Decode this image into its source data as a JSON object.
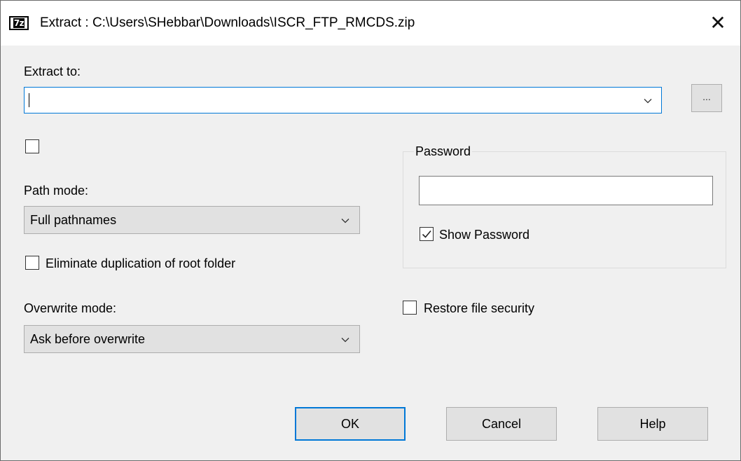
{
  "window": {
    "title": "Extract : C:\\Users\\SHebbar\\Downloads\\ISCR_FTP_RMCDS.zip",
    "app_icon_text": "7z",
    "close_glyph": "✕"
  },
  "extract_to": {
    "label": "Extract to:",
    "value": "",
    "browse_label": "..."
  },
  "extra_checkbox": {
    "checked": false
  },
  "path_mode": {
    "label": "Path mode:",
    "selected": "Full pathnames"
  },
  "eliminate_duplication": {
    "label": "Eliminate duplication of root folder",
    "checked": false
  },
  "overwrite_mode": {
    "label": "Overwrite mode:",
    "selected": "Ask before overwrite"
  },
  "password_group": {
    "title": "Password",
    "value": "",
    "show_password_label": "Show Password",
    "show_password_checked": true
  },
  "restore_security": {
    "label": "Restore file security",
    "checked": false
  },
  "buttons": {
    "ok": "OK",
    "cancel": "Cancel",
    "help": "Help"
  },
  "colors": {
    "accent": "#0078d7",
    "dialog_bg": "#f0f0f0",
    "button_bg": "#e1e1e1"
  },
  "icons": {
    "app": "7zip-logo-icon",
    "close": "close-icon",
    "dropdown": "chevron-down-icon",
    "check": "checkmark-icon"
  }
}
